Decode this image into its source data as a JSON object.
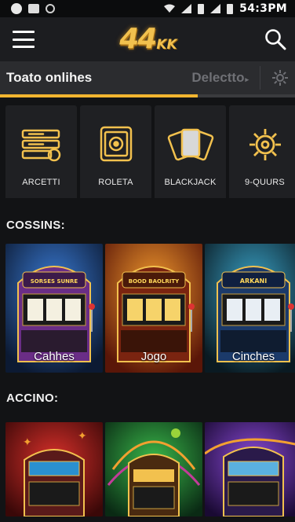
{
  "status_bar": {
    "time": "54:3PM"
  },
  "header": {
    "logo_main": "44",
    "logo_sub": "KK"
  },
  "tabbar": {
    "title": "Toato onlihes",
    "select_label": "Delectto",
    "progress_fraction": 0.67
  },
  "categories": [
    {
      "label": "ARCETTI",
      "icon": "cash-stack-icon"
    },
    {
      "label": "ROLETA",
      "icon": "roulette-icon"
    },
    {
      "label": "BLACKJACK",
      "icon": "playing-cards-icon"
    },
    {
      "label": "9-QUURS",
      "icon": "gear-icon"
    }
  ],
  "sections": [
    {
      "title": "COSSINS:",
      "games": [
        {
          "label": "Cahhes",
          "sign": "SORSES SUNRE"
        },
        {
          "label": "Jogo",
          "sign": "BOOD BAOLRITY"
        },
        {
          "label": "Cinches",
          "sign": "ARKANI"
        }
      ]
    },
    {
      "title": "ACCINO:",
      "games": [
        {
          "label": ""
        },
        {
          "label": ""
        },
        {
          "label": ""
        }
      ]
    }
  ],
  "colors": {
    "accent": "#f2b630",
    "background": "#121315",
    "header": "#1c1d20",
    "tabbar": "#2b2c2f",
    "card": "#1f2023"
  }
}
